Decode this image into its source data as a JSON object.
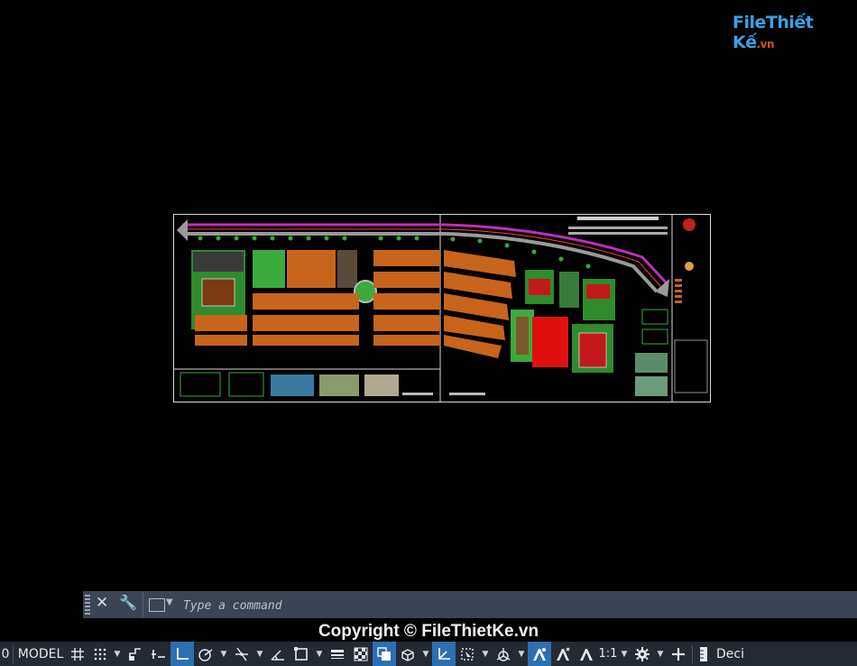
{
  "watermark_logo": {
    "main": "FileThiết Kế",
    "suffix": ".vn"
  },
  "command_line": {
    "placeholder": "Type a command"
  },
  "copyright": "Copyright © FileThietKe.vn",
  "status_bar": {
    "left_value": "0",
    "model_label": "MODEL",
    "scale_label": "1:1",
    "units_label": "Deci"
  },
  "colors": {
    "background": "#000000",
    "command_bar": "#3b4453",
    "status_bar": "#232a33",
    "toggle_on": "#2c6fb3",
    "plot_orange": "#c8641c",
    "plot_green": "#2e8b2e",
    "road_magenta": "#c02cc0",
    "court_red": "#d01515"
  }
}
